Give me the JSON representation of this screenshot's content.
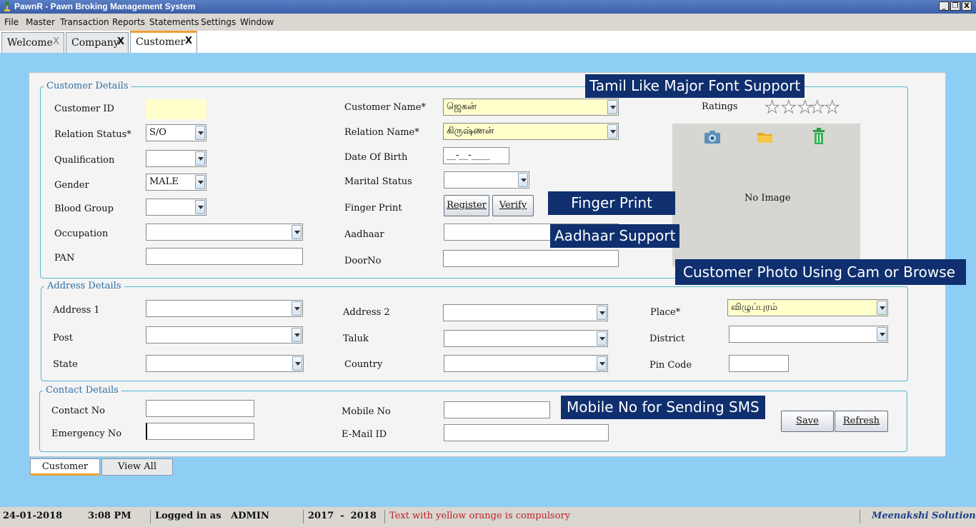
{
  "window": {
    "title": "PawnR - Pawn Broking Management System",
    "minimize": "_",
    "restore": "❐",
    "close": "X"
  },
  "menu": [
    "File",
    "Master",
    "Transaction",
    "Reports",
    "Statements",
    "Settings",
    "Window"
  ],
  "tabs": [
    {
      "label": "Welcome",
      "close": "X"
    },
    {
      "label": "Company",
      "close": "X"
    },
    {
      "label": "Customer",
      "close": "X"
    }
  ],
  "customer_details": {
    "legend": "Customer Details",
    "customer_id_label": "Customer ID",
    "customer_id_value": "",
    "relation_status_label": "Relation Status*",
    "relation_status_value": "S/O",
    "qualification_label": "Qualification",
    "qualification_value": "",
    "gender_label": "Gender",
    "gender_value": "MALE",
    "blood_group_label": "Blood Group",
    "blood_group_value": "",
    "occupation_label": "Occupation",
    "occupation_value": "",
    "pan_label": "PAN",
    "pan_value": "",
    "customer_name_label": "Customer Name*",
    "customer_name_value": "ஜெகன்",
    "relation_name_label": "Relation Name*",
    "relation_name_value": "கிருஷ்ணன்",
    "dob_label": "Date Of Birth",
    "dob_value": "__-__-____",
    "marital_label": "Marital Status",
    "marital_value": "",
    "finger_label": "Finger Print",
    "register_label": "Register",
    "verify_label": "Verify",
    "aadhaar_label": "Aadhaar",
    "aadhaar_value": "",
    "doorno_label": "DoorNo",
    "doorno_value": "",
    "ratings_label": "Ratings",
    "ratings_value": 0,
    "ratings_max": 5,
    "no_image": "No Image"
  },
  "address_details": {
    "legend": "Address Details",
    "address1_label": "Address 1",
    "address1_value": "",
    "post_label": "Post",
    "post_value": "",
    "state_label": "State",
    "state_value": "",
    "address2_label": "Address 2",
    "address2_value": "",
    "taluk_label": "Taluk",
    "taluk_value": "",
    "country_label": "Country",
    "country_value": "",
    "place_label": "Place*",
    "place_value": "விழுப்புரம்",
    "district_label": "District",
    "district_value": "",
    "pincode_label": "Pin Code",
    "pincode_value": ""
  },
  "contact_details": {
    "legend": "Contact Details",
    "contact_label": "Contact No",
    "contact_value": "",
    "emergency_label": "Emergency No",
    "emergency_value": "",
    "mobile_label": "Mobile No",
    "mobile_value": "",
    "email_label": "E-Mail ID",
    "email_value": "",
    "save_label": "Save",
    "refresh_label": "Refresh"
  },
  "callouts": {
    "font": "Tamil Like Major Font Support",
    "finger": "Finger Print",
    "aadhaar": "Aadhaar Support",
    "photo": "Customer Photo Using Cam or Browse",
    "sms": "Mobile No for Sending SMS"
  },
  "bottom_tabs": [
    "Customer",
    "View All"
  ],
  "status": {
    "date": "24-01-2018",
    "time": "3:08 PM",
    "logged_in": "Logged in as   ADMIN",
    "year": "2017  -  2018",
    "hint": "Text with yellow orange is compulsory",
    "vendor": "Meenakshi Solutions"
  },
  "colors": {
    "accent": "#f0a030",
    "compulsory_field": "#ffffcc",
    "callout_bg": "#0f2f6e",
    "hint_text": "#c0202a",
    "vendor_text": "#1d3f8a"
  }
}
